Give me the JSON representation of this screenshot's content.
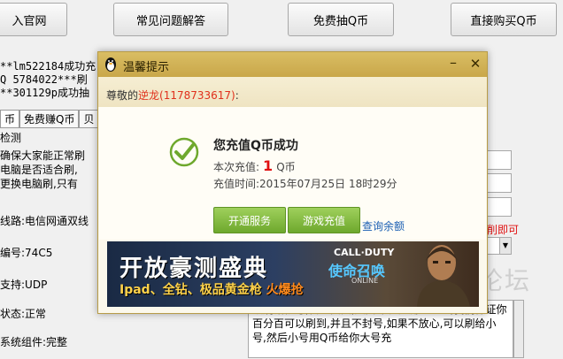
{
  "top_buttons": [
    "入官网",
    "常见问题解答",
    "免费抽Q币",
    "直接购买Q币"
  ],
  "log_lines": [
    "**lm522184成功充",
    "Q 5784022***刷",
    "**301129p成功抽"
  ],
  "tabs": [
    "币",
    "免费赚Q币",
    "贝"
  ],
  "left_panel": {
    "heading": "检测",
    "lines": [
      "确保大家能正常刷",
      "电脑是否适合刷,",
      "更换电脑刷,只有"
    ]
  },
  "status_lines": [
    "线路:电信网通双线",
    "编号:74C5",
    "支持:UDP",
    "状态:正常",
    "系统组件:完整"
  ],
  "right_red_text": "削即可",
  "watermark": "论坛",
  "notice_text": "致刷错帐号,自己负责,只要环境检测通过的,我们保证你百分百可以刷到,并且不封号,如果不放心,可以刷给小号,然后小号用Q币给你大号充",
  "dialog": {
    "title": "温馨提示",
    "greeting_prefix": "尊敬的",
    "nickname": "逆龙(1178733617)",
    "greeting_suffix": ":",
    "success_text": "您充值Q币成功",
    "amount_label": "本次充值:",
    "amount_value": "1",
    "amount_unit": "Q币",
    "time_label": "充值时间:",
    "time_value": "2015年07月25日 18时29分",
    "btn_open": "开通服务",
    "btn_game": "游戏充值",
    "link_query": "查询余额",
    "banner": {
      "title": "开放豪测盛典",
      "subtitle": "Ipad、全钻、极品黄金枪",
      "subtitle_hot": "火爆抢",
      "brand_en": "CALL·DUTY",
      "brand_cn": "使命召唤",
      "brand_online": "ONLINE"
    }
  },
  "colors": {
    "accent_green": "#6ea82d",
    "title_gold": "#c9a74a",
    "red": "#e01010",
    "link": "#1b5fb3"
  }
}
